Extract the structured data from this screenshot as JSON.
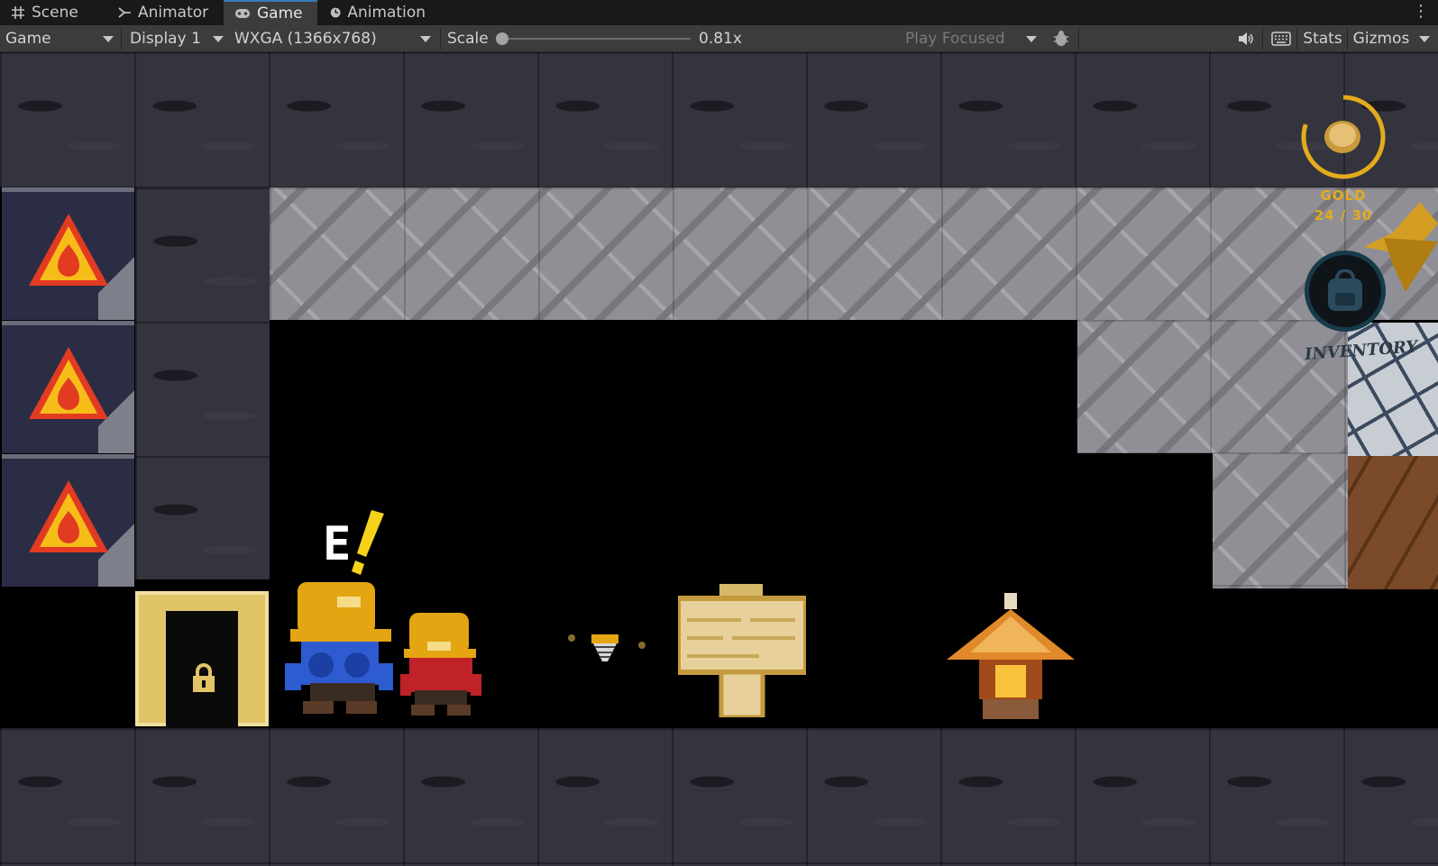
{
  "tabs": [
    {
      "label": "Scene",
      "icon": "grid-icon"
    },
    {
      "label": "Animator",
      "icon": "animator-icon"
    },
    {
      "label": "Game",
      "icon": "gamepad-icon",
      "active": true
    },
    {
      "label": "Animation",
      "icon": "clock-icon"
    }
  ],
  "toolbar": {
    "view_mode": "Game",
    "display": "Display 1",
    "resolution": "WXGA (1366x768)",
    "scale_label": "Scale",
    "scale_value": "0.81x",
    "scale_fraction": 0.0,
    "play_mode": "Play Focused",
    "stats_label": "Stats",
    "gizmos_label": "Gizmos"
  },
  "hud": {
    "gold_label": "GOLD",
    "gold_count": "24 / 30",
    "gold_ring_fraction": 0.8,
    "inventory_label": "INVENTORY"
  },
  "world": {
    "interact_key": "E"
  },
  "colors": {
    "accent_tab": "#3a79bb",
    "gold": "#e3ac1d",
    "hazard_red": "#e23b22",
    "hazard_yellow": "#f6bd19"
  }
}
